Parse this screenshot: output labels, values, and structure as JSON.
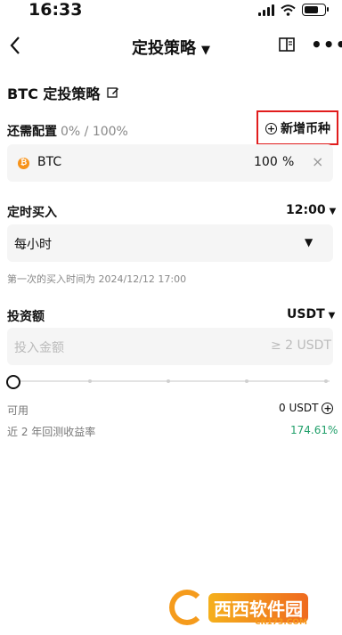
{
  "status_bar": {
    "time": "16:33"
  },
  "nav": {
    "title": "定投策略",
    "back_icon": "chevron-left-icon",
    "guide_icon": "book-icon",
    "more_icon": "more-horizontal-icon"
  },
  "strategy": {
    "name": "BTC 定投策略",
    "edit_icon": "edit-icon"
  },
  "allocation": {
    "label": "还需配置",
    "progress": "0% / 100%",
    "add_coin_label": "新增币种",
    "highlight_color": "#e11d1d",
    "coins": [
      {
        "symbol": "BTC",
        "percent": "100",
        "unit": "%",
        "remove": "×"
      }
    ]
  },
  "schedule": {
    "label": "定时买入",
    "time": "12:00",
    "frequency": "每小时",
    "first_buy": "第一次的买入时间为 2024/12/12 17:00"
  },
  "investment": {
    "label": "投资额",
    "currency": "USDT",
    "placeholder": "投入金额",
    "minimum": "≥ 2 USDT",
    "slider_percent": 0
  },
  "balance": {
    "available_label": "可用",
    "available_value": "0 USDT",
    "yield_label": "近 2 年回测收益率",
    "yield_value": "174.61%",
    "yield_color": "#22a06b"
  },
  "watermark": {
    "brand": "西西软件园",
    "url": "CR173.COM"
  }
}
